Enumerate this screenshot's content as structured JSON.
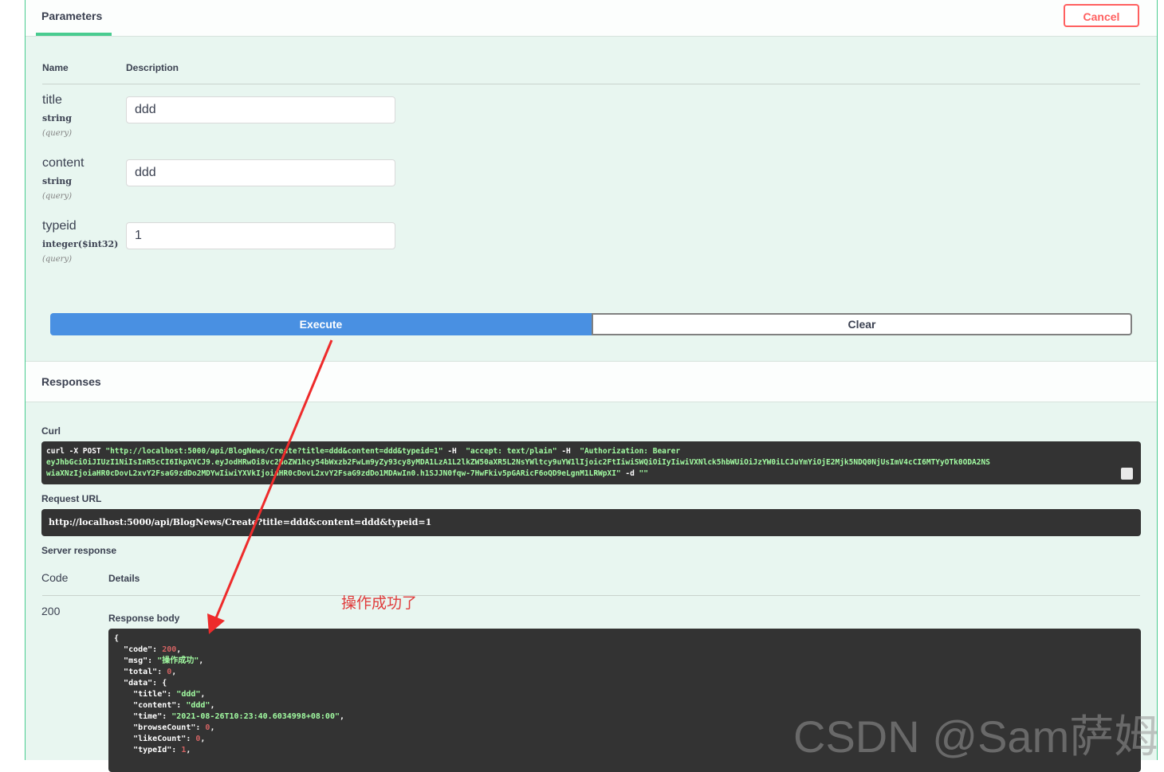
{
  "params": {
    "tab_label": "Parameters",
    "cancel_label": "Cancel",
    "col_name": "Name",
    "col_description": "Description",
    "rows": [
      {
        "name": "title",
        "type": "string",
        "in": "(query)",
        "value": "ddd"
      },
      {
        "name": "content",
        "type": "string",
        "in": "(query)",
        "value": "ddd"
      },
      {
        "name": "typeid",
        "type": "integer($int32)",
        "in": "(query)",
        "value": "1"
      }
    ],
    "execute_label": "Execute",
    "clear_label": "Clear"
  },
  "responses": {
    "title": "Responses",
    "curl_label": "Curl",
    "curl_line1_a": "curl -X POST ",
    "curl_line1_b": "\"http://localhost:5000/api/BlogNews/Create?title=ddd&content=ddd&typeid=1\"",
    "curl_line1_c": " -H  ",
    "curl_line1_d": "\"accept: text/plain\"",
    "curl_line1_e": " -H  ",
    "curl_line1_f": "\"Authorization: Bearer",
    "curl_line2": "eyJhbGciOiJIUzI1NiIsInR5cCI6IkpXVCJ9.eyJodHRwOi8vc2NoZW1hcy54bWxzb2FwLm9yZy93cy8yMDA1LzA1L2lkZW50aXR5L2NsYWltcy9uYW1lIjoic2FtIiwiSWQiOiIyIiwiVXNlck5hbWUiOiJzYW0iLCJuYmYiOjE2Mjk5NDQ0NjUsImV4cCI6MTYyOTk0ODA2NS",
    "curl_line3_a": "wiaXNzIjoiaHR0cDovL2xvY2FsaG9zdDo2MDYwIiwiYXVkIjoiaHR0cDovL2xvY2FsaG9zdDo1MDAwIn0.h1SJJN0fqw-7HwFkiv5pGARicF6oQD9eLgnM1LRWpXI\"",
    "curl_line3_b": " -d ",
    "curl_line3_c": "\"\"",
    "request_url_label": "Request URL",
    "request_url": "http://localhost:5000/api/BlogNews/Create?title=ddd&content=ddd&typeid=1",
    "server_response_label": "Server response",
    "code_header": "Code",
    "details_header": "Details",
    "code_value": "200",
    "response_body_label": "Response body",
    "body": {
      "open": "{",
      "code_key": "\"code\"",
      "code_val": "200",
      "msg_key": "\"msg\"",
      "msg_val": "\"操作成功\"",
      "total_key": "\"total\"",
      "total_val": "0",
      "data_key": "\"data\"",
      "title_key": "\"title\"",
      "title_val": "\"ddd\"",
      "content_key": "\"content\"",
      "content_val": "\"ddd\"",
      "time_key": "\"time\"",
      "time_val": "\"2021-08-26T10:23:40.6034998+08:00\"",
      "browse_key": "\"browseCount\"",
      "browse_val": "0",
      "like_key": "\"likeCount\"",
      "like_val": "0",
      "typeid_key": "\"typeId\"",
      "typeid_val": "1"
    }
  },
  "annotation": "操作成功了",
  "watermark": "CSDN @Sam萨姆",
  "colors": {
    "accent_green": "#49cc90",
    "execute_blue": "#4990e2",
    "cancel_red": "#ff6060",
    "annotation_red": "#e03c3c"
  }
}
